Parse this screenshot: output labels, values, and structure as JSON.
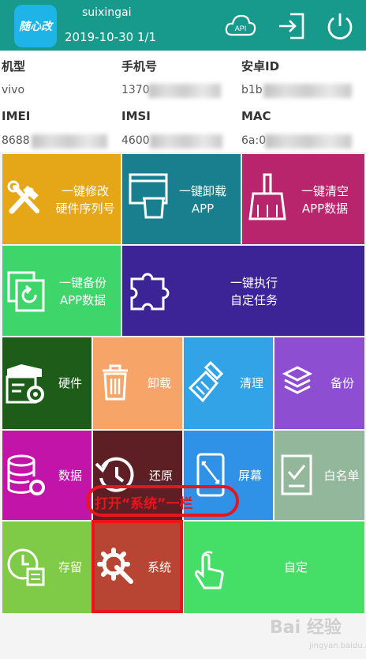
{
  "header": {
    "logo_text": "随心改",
    "username": "suixingai",
    "date_info": "2019-10-30 1/1",
    "icons": [
      "cloud-api-icon",
      "login-icon",
      "power-icon"
    ],
    "api_label": "API"
  },
  "device_info": {
    "model_label": "机型",
    "model_value": "vivo",
    "phone_label": "手机号",
    "phone_value": "1370",
    "android_id_label": "安卓ID",
    "android_id_value": "b1b",
    "imei_label": "IMEI",
    "imei_value": "8688",
    "imsi_label": "IMSI",
    "imsi_value": "4600",
    "mac_label": "MAC",
    "mac_value": "6a:0"
  },
  "tiles": {
    "modify_serial": "一键修改\n硬件序列号",
    "uninstall_app": "一键卸载\nAPP",
    "clear_app_data": "一键清空\nAPP数据",
    "backup_app_data": "一键备份\nAPP数据",
    "run_custom_task": "一键执行\n自定任务",
    "hardware": "硬件",
    "uninstall": "卸载",
    "clean": "清理",
    "backup": "备份",
    "data": "数据",
    "restore": "还原",
    "screen": "屏幕",
    "whitelist": "白名单",
    "storage": "存留",
    "system": "系统",
    "custom": "自定"
  },
  "annotation": {
    "text": "打开“系统”一栏"
  },
  "watermark": {
    "text": "Bai 经验",
    "sub": "jingyan.baidu.com"
  },
  "colors": {
    "header": "#179a8b",
    "annotation_red": "#e8161c",
    "orange_yellow": "#e5a718",
    "teal": "#197f8e",
    "magenta": "#b9256d",
    "green": "#3ed56a",
    "indigo": "#3c2496",
    "dark_green": "#1d5c19",
    "peach": "#f6a467",
    "sky_blue": "#31a3e6",
    "purple": "#8d4ed2",
    "pink_magenta": "#c314a9",
    "maroon": "#5e1f24",
    "blue": "#2f92e7",
    "sage": "#93b79a",
    "lime": "#7fcb47",
    "rust": "#b84533",
    "bright_green": "#45de67"
  }
}
